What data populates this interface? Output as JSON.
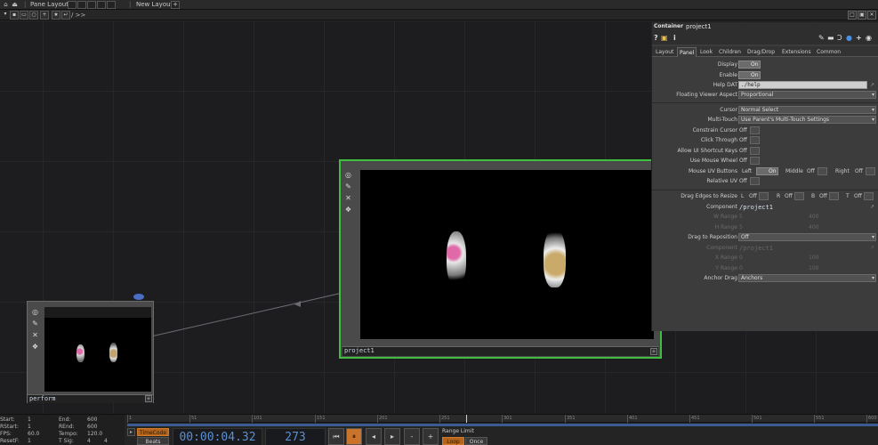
{
  "topbar": {
    "pane_layout_label": "Pane Layout",
    "new_layout_label": "New Layout",
    "path_text": "/ >>"
  },
  "nodes": {
    "perform": {
      "name": "perform"
    },
    "project1": {
      "name": "project1"
    }
  },
  "params": {
    "op_type": "Container",
    "op_name": "project1",
    "help_symbols": "? i",
    "tabs": [
      "Layout",
      "Panel",
      "Look",
      "Children",
      "Drag/Drop",
      "Extensions",
      "Common"
    ],
    "active_tab": "Panel",
    "rows": {
      "display": {
        "label": "Display",
        "value": "On"
      },
      "enable": {
        "label": "Enable",
        "value": "On"
      },
      "help_dat": {
        "label": "Help DAT",
        "value": "./help"
      },
      "floating_viewer_aspect": {
        "label": "Floating Viewer Aspect",
        "value": "Proportional"
      },
      "cursor": {
        "label": "Cursor",
        "value": "Normal Select"
      },
      "multi_touch": {
        "label": "Multi-Touch",
        "value": "Use Parent's Multi-Touch Settings"
      },
      "constrain_cursor": {
        "label": "Constrain Cursor",
        "value": "Off"
      },
      "click_through": {
        "label": "Click Through",
        "value": "Off"
      },
      "allow_ui_shortcut_keys": {
        "label": "Allow UI Shortcut Keys",
        "value": "Off"
      },
      "use_mouse_wheel": {
        "label": "Use Mouse Wheel",
        "value": "Off"
      },
      "mouse_uv_buttons": {
        "label": "Mouse UV Buttons",
        "left": "Left",
        "left_value": "On",
        "middle": "Middle",
        "middle_value": "Off",
        "right": "Right",
        "right_value": "Off"
      },
      "relative_uv": {
        "label": "Relative UV",
        "value": "Off"
      },
      "drag_edges": {
        "label": "Drag Edges to Resize",
        "l": "L",
        "l_value": "Off",
        "r": "R",
        "r_value": "Off",
        "b": "B",
        "b_value": "Off",
        "t": "T",
        "t_value": "Off"
      },
      "component": {
        "label": "Component",
        "value": "/project1"
      },
      "w_range": {
        "label": "W Range",
        "min": "5",
        "max": "400"
      },
      "h_range": {
        "label": "H Range",
        "min": "5",
        "max": "400"
      },
      "drag_to_reposition": {
        "label": "Drag to Reposition",
        "value": "Off"
      },
      "component2": {
        "label": "Component",
        "value": "/project1"
      },
      "x_range": {
        "label": "X Range",
        "min": "0",
        "max": "100"
      },
      "y_range": {
        "label": "Y Range",
        "min": "0",
        "max": "100"
      },
      "anchor_drag": {
        "label": "Anchor Drag",
        "value": "Anchors"
      }
    }
  },
  "timeline": {
    "stats": {
      "start_label": "Start:",
      "start": "1",
      "rstart_label": "RStart:",
      "rstart": "1",
      "fps_label": "FPS:",
      "fps": "60.0",
      "resetf_label": "ResetF:",
      "resetf": "1",
      "end_label": "End:",
      "end": "600",
      "rend_label": "REnd:",
      "rend": "600",
      "tempo_label": "Tempo:",
      "tempo": "120.0",
      "tsig_label": "T Sig:",
      "tsig_a": "4",
      "tsig_b": "4"
    },
    "ruler_ticks": [
      "1",
      "51",
      "101",
      "151",
      "201",
      "251",
      "301",
      "351",
      "401",
      "451",
      "501",
      "551",
      "600"
    ],
    "timecode_label": "TimeCode",
    "beats_label": "Beats",
    "time_display": "00:00:04.32",
    "frame_display": "273",
    "range_limit_label": "Range Limit",
    "loop_label": "Loop",
    "once_label": "Once",
    "play_controls": [
      "rewind",
      "pause",
      "step-back",
      "step-forward",
      "minus",
      "plus"
    ]
  },
  "colors": {
    "selection_green": "#3fbf3f",
    "timeline_blue": "#3b5a8f",
    "accent_orange": "#c9742a"
  }
}
